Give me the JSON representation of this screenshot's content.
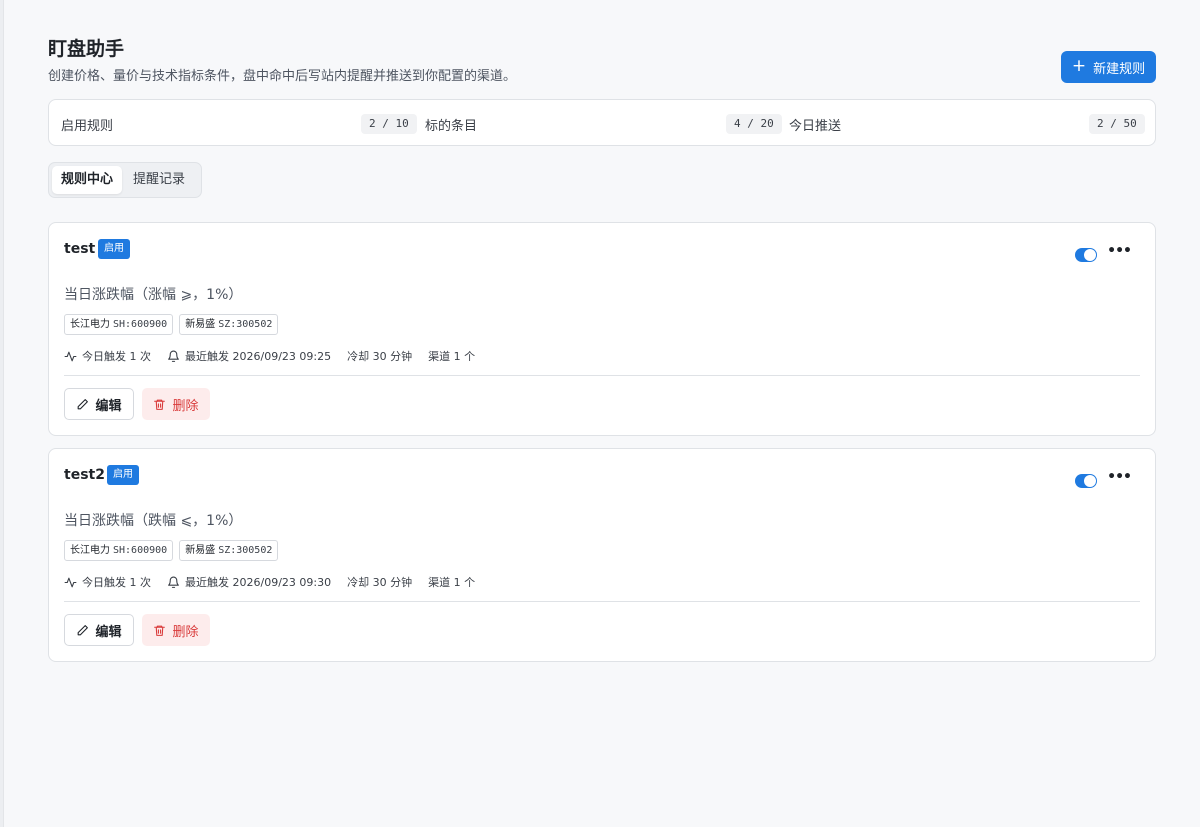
{
  "header": {
    "title": "盯盘助手",
    "subtitle": "创建价格、量价与技术指标条件，盘中命中后写站内提醒并推送到你配置的渠道。",
    "new_rule_plus": "+",
    "new_rule_label": "新建规则"
  },
  "stats": [
    {
      "label": "启用规则",
      "value": "2 / 10"
    },
    {
      "label": "标的条目",
      "value": "4 / 20"
    },
    {
      "label": "今日推送",
      "value": "2 / 50"
    }
  ],
  "tabs": [
    {
      "label": "规则中心",
      "active": true
    },
    {
      "label": "提醒记录",
      "active": false
    }
  ],
  "rules": [
    {
      "name": "test",
      "status": "启用",
      "enabled": true,
      "condition": "当日涨跌幅（涨幅 ⩾，1%）",
      "symbols": [
        {
          "name": "长江电力",
          "code": "SH:600900"
        },
        {
          "name": "新易盛",
          "code": "SZ:300502"
        }
      ],
      "today_triggers": "今日触发 1 次",
      "last_trigger": "最近触发 2026/09/23 09:25",
      "cooldown": "冷却 30 分钟",
      "channels": "渠道 1 个",
      "edit_label": "编辑",
      "delete_label": "删除"
    },
    {
      "name": "test2",
      "status": "启用",
      "enabled": true,
      "condition": "当日涨跌幅（跌幅 ⩽，1%）",
      "symbols": [
        {
          "name": "长江电力",
          "code": "SH:600900"
        },
        {
          "name": "新易盛",
          "code": "SZ:300502"
        }
      ],
      "today_triggers": "今日触发 1 次",
      "last_trigger": "最近触发 2026/09/23 09:30",
      "cooldown": "冷却 30 分钟",
      "channels": "渠道 1 个",
      "edit_label": "编辑",
      "delete_label": "删除"
    }
  ],
  "more_glyph": "•••",
  "colors": {
    "accent": "#1f7ae0",
    "danger": "#d93a3a",
    "danger_bg": "#fdecec"
  }
}
